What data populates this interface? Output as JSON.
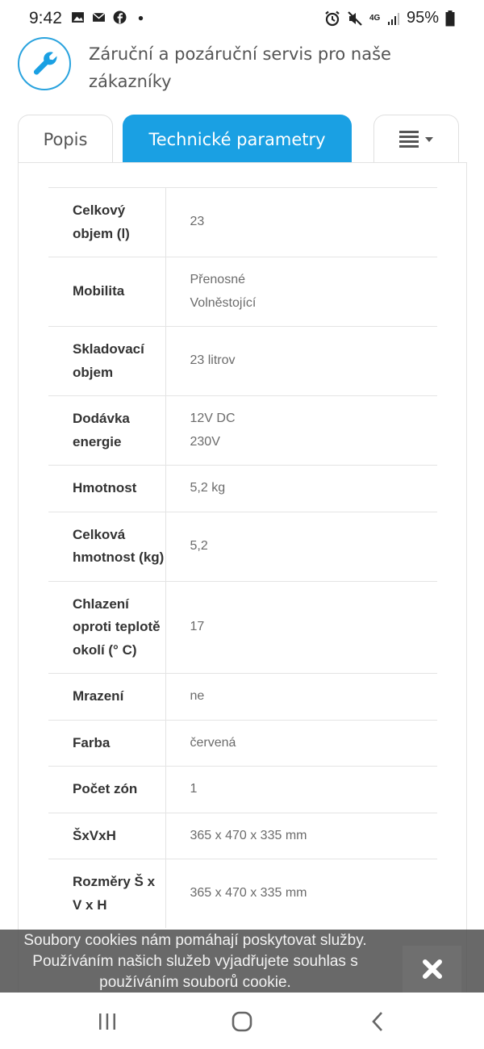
{
  "status_bar": {
    "time": "9:42",
    "network": "4G",
    "battery": "95%",
    "left_icons": [
      "image-icon",
      "mail-icon",
      "facebook-icon",
      "dot-icon"
    ],
    "right_icons": [
      "alarm-icon",
      "mute-icon",
      "network-4g-icon",
      "signal-icon",
      "battery-icon"
    ]
  },
  "service": {
    "icon": "wrench-icon",
    "text": "Záruční a pozáruční servis pro naše zákazníky"
  },
  "tabs": [
    {
      "label": "Popis",
      "active": false
    },
    {
      "label": "Technické parametry",
      "active": true
    },
    {
      "label": "",
      "icon": "menu-icon",
      "active": false
    }
  ],
  "specs": [
    {
      "key": "Celkový objem (l)",
      "values": [
        "23"
      ]
    },
    {
      "key": "Mobilita",
      "values": [
        "Přenosné",
        "Volněstojící"
      ]
    },
    {
      "key": "Skladovací objem",
      "values": [
        "23 litrov"
      ]
    },
    {
      "key": "Dodávka energie",
      "values": [
        "12V DC",
        "230V"
      ]
    },
    {
      "key": "Hmotnost",
      "values": [
        "5,2 kg"
      ]
    },
    {
      "key": "Celková hmotnost (kg)",
      "values": [
        "5,2"
      ]
    },
    {
      "key": "Chlazení oproti teplotě okolí (° C)",
      "values": [
        "17"
      ]
    },
    {
      "key": "Mrazení",
      "values": [
        "ne"
      ]
    },
    {
      "key": "Farba",
      "values": [
        "červená"
      ]
    },
    {
      "key": "Počet zón",
      "values": [
        "1"
      ]
    },
    {
      "key": "ŠxVxH",
      "values": [
        "365 x 470 x 335 mm"
      ]
    },
    {
      "key": "Rozměry Š x V x H",
      "values": [
        "365 x 470 x 335 mm"
      ]
    }
  ],
  "cookie": {
    "line1": "Soubory cookies nám pomáhají poskytovat služby.",
    "line2": "Používáním našich služeb vyjadřujete souhlas s",
    "line3": "používáním souborů cookie.",
    "close_icon": "close-icon"
  },
  "nav_bar": {
    "icons": [
      "recents-icon",
      "home-icon",
      "back-icon"
    ]
  },
  "colors": {
    "accent": "#1aa0e3",
    "icon_ring": "#2aa3de",
    "banner": "#505050"
  }
}
